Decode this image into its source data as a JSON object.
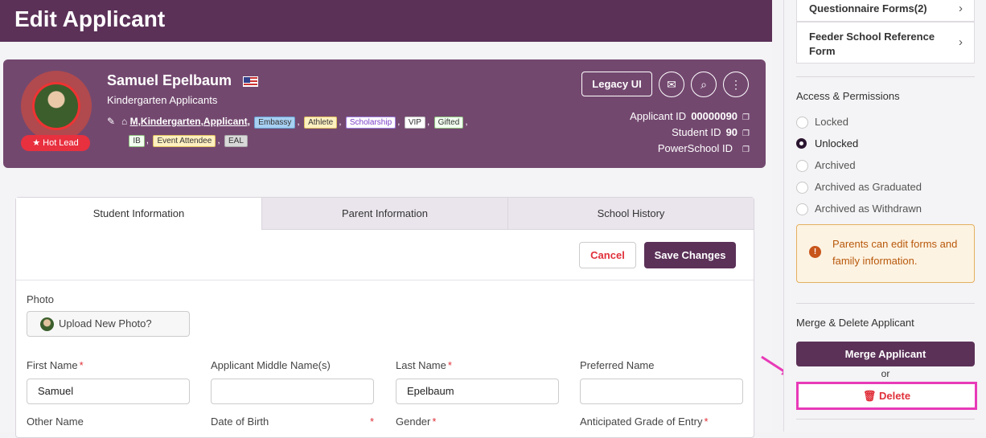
{
  "page": {
    "title": "Edit Applicant"
  },
  "profile": {
    "name": "Samuel Epelbaum",
    "subtitle": "Kindergarten Applicants",
    "hot_lead": "★ Hot Lead",
    "tags_prefix": "M,Kindergarten,Applicant,",
    "tags": [
      {
        "label": "Embassy",
        "style": "blue"
      },
      {
        "label": "Athlete",
        "style": "yellow"
      },
      {
        "label": "Scholarship",
        "style": "purple"
      },
      {
        "label": "VIP",
        "style": "plain"
      },
      {
        "label": "Gifted",
        "style": "green"
      },
      {
        "label": "IB",
        "style": "green"
      },
      {
        "label": "Event Attendee",
        "style": "yellow"
      },
      {
        "label": "EAL",
        "style": "gray"
      }
    ],
    "legacy_label": "Legacy UI",
    "ids": {
      "applicant_label": "Applicant ID",
      "applicant_value": "00000090",
      "student_label": "Student ID",
      "student_value": "90",
      "powerschool_label": "PowerSchool ID",
      "powerschool_value": ""
    }
  },
  "tabs": [
    "Student Information",
    "Parent Information",
    "School History"
  ],
  "form_actions": {
    "cancel": "Cancel",
    "save": "Save Changes"
  },
  "photo": {
    "label": "Photo",
    "upload": "Upload New Photo?"
  },
  "fields": {
    "first_name": {
      "label": "First Name",
      "value": "Samuel"
    },
    "middle_name": {
      "label": "Applicant Middle Name(s)",
      "value": ""
    },
    "last_name": {
      "label": "Last Name",
      "value": "Epelbaum"
    },
    "preferred_name": {
      "label": "Preferred Name",
      "value": ""
    },
    "other_name": {
      "label": "Other Name"
    },
    "dob": {
      "label": "Date of Birth"
    },
    "gender": {
      "label": "Gender"
    },
    "grade": {
      "label": "Anticipated Grade of Entry"
    }
  },
  "sidebar": {
    "links": [
      "Questionnaire Forms(2)",
      "Feeder School Reference Form"
    ],
    "access_title": "Access & Permissions",
    "access_options": [
      "Locked",
      "Unlocked",
      "Archived",
      "Archived as Graduated",
      "Archived as Withdrawn"
    ],
    "access_selected": "Unlocked",
    "notice": "Parents can edit forms and family information.",
    "merge_title": "Merge & Delete Applicant",
    "merge_button": "Merge Applicant",
    "or": "or",
    "delete_button": "🗑 Delete"
  },
  "colors": {
    "brand": "#5b3158",
    "danger": "#e0303a",
    "highlight": "#e83ab8"
  }
}
